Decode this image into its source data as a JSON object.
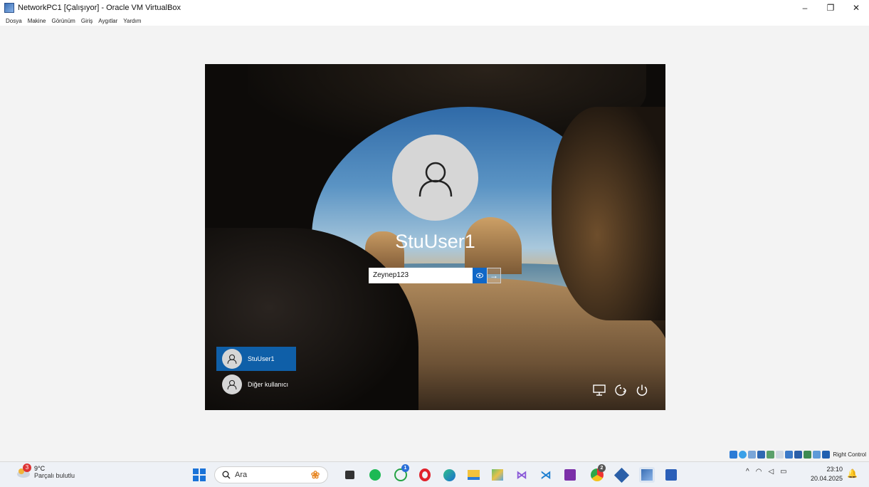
{
  "window": {
    "title": "NetworkPC1 [Çalışıyor] - Oracle VM VirtualBox",
    "controls": {
      "minimize": "–",
      "restore": "❐",
      "close": "✕"
    }
  },
  "menubar": [
    "Dosya",
    "Makine",
    "Görünüm",
    "Giriş",
    "Aygıtlar",
    "Yardım"
  ],
  "login": {
    "username": "StuUser1",
    "password_value": "Zeynep123",
    "submit_glyph": "→",
    "users": [
      {
        "label": "StuUser1",
        "selected": true
      },
      {
        "label": "Diğer kullanıcı",
        "selected": false
      }
    ],
    "bottom_icons": [
      "network-icon",
      "accessibility-icon",
      "power-icon"
    ]
  },
  "vm_status": {
    "right_control": "Right Control"
  },
  "taskbar": {
    "weather": {
      "badge": "3",
      "temp": "9°C",
      "condition": "Parçalı bulutlu"
    },
    "search_placeholder": "Ara",
    "apps": [
      "widgets",
      "task-view",
      "spotify",
      "whatsapp",
      "opera",
      "edge",
      "file-explorer",
      "photos",
      "visual-studio",
      "vscode",
      "onenote",
      "chrome",
      "virtualbox",
      "networkpc1-vm",
      "word"
    ],
    "whatsapp_badge": "1",
    "chrome_badge": "2",
    "clock": {
      "time": "23:10",
      "date": "20.04.2025"
    }
  }
}
